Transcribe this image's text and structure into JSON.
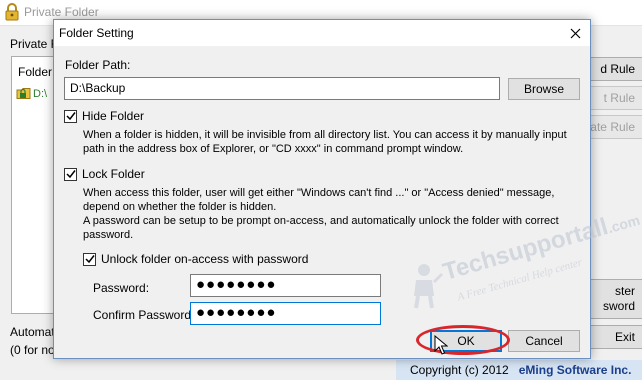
{
  "main_window": {
    "title": "Private Folder",
    "tab_label": "Private F",
    "list_header": "Folder",
    "list_item": "D:\\",
    "buttons": {
      "add_rule": "d Rule",
      "edit_rule": "t Rule",
      "delete_rule": "ate Rule",
      "master_password_line1": "ster",
      "master_password_line2": "sword",
      "exit": "Exit"
    },
    "auto_label": "Automati",
    "auto_sub": "(0 for no",
    "footer_copyright": "Copyright (c) 2012",
    "footer_brand": "eMing Software Inc."
  },
  "dialog": {
    "title": "Folder Setting",
    "folder_path_label": "Folder Path:",
    "folder_path_value": "D:\\Backup",
    "browse_label": "Browse",
    "hide_folder": {
      "label": "Hide Folder",
      "checked": true,
      "desc_line1": "When a folder is hidden, it will be invisible from all directory list. You can access it by manually input",
      "desc_line2": "path in the address box of Explorer, or \"CD xxxx\" in command prompt window."
    },
    "lock_folder": {
      "label": "Lock Folder",
      "checked": true,
      "desc_line1": "When access this folder, user will get either \"Windows can't find ...\" or \"Access denied\" message,",
      "desc_line2": "depend on whether the folder is hidden.",
      "desc_line3": "A password can be setup to be prompt on-access, and automatically unlock the folder with correct",
      "desc_line4": "password."
    },
    "unlock_on_access": {
      "label": "Unlock folder on-access with password",
      "checked": true
    },
    "password_label": "Password:",
    "password_value": "●●●●●●●●",
    "confirm_label": "Confirm Password:",
    "confirm_value": "●●●●●●●●",
    "ok_label": "OK",
    "cancel_label": "Cancel"
  },
  "watermark": {
    "main": "Techsupportall",
    "domain": ".com",
    "tagline": "A Free Technical Help center"
  },
  "colors": {
    "accent": "#0078d7",
    "annotation_red": "#d9262b",
    "footer_bg": "#d6e4f4",
    "brand_blue": "#1c3f8c"
  },
  "icons": {
    "app_icon": "padlock-icon",
    "folder_icon": "locked-folder-icon",
    "close_icon": "close-icon",
    "cursor": "mouse-pointer-icon"
  }
}
